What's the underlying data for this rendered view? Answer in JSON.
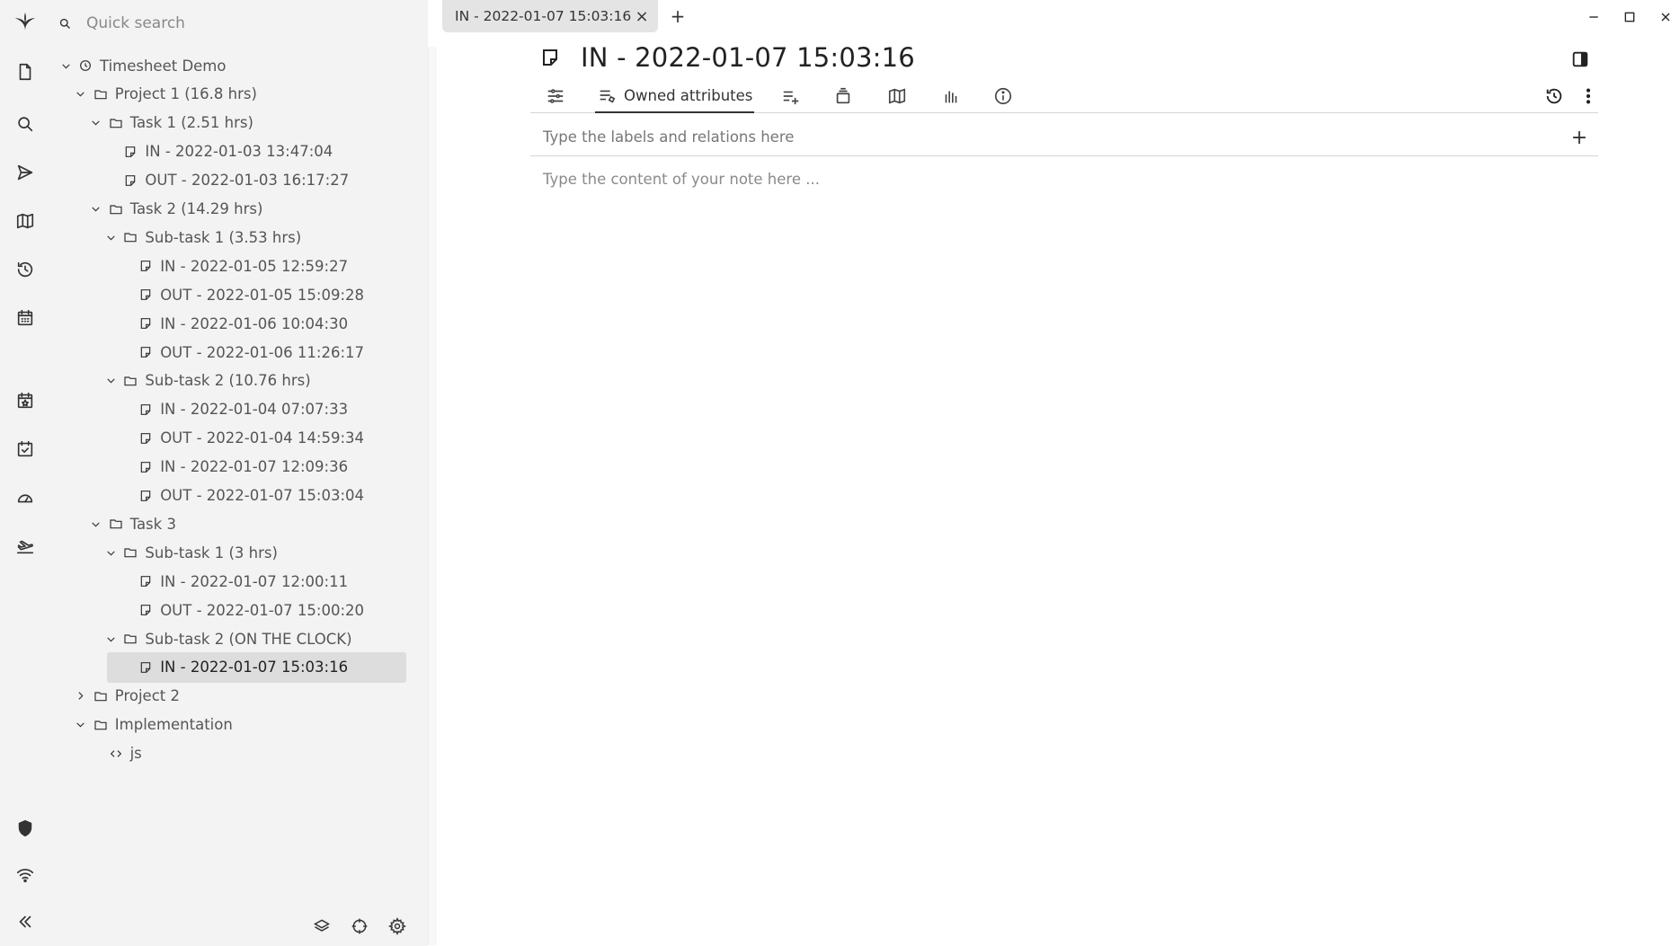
{
  "app": {
    "logo_icon": "trilium-logo-icon"
  },
  "launcher": {
    "buttons": [
      {
        "name": "new-note-button",
        "icon": "file-icon"
      },
      {
        "name": "search-button",
        "icon": "search-icon"
      },
      {
        "name": "jump-to-note-button",
        "icon": "send-icon"
      },
      {
        "name": "note-map-button",
        "icon": "map-icon"
      },
      {
        "name": "recent-changes-button",
        "icon": "history-icon"
      },
      {
        "name": "calendar-button",
        "icon": "calendar-icon"
      },
      {
        "name": "bookmark-button",
        "icon": "calendar-star-icon"
      },
      {
        "name": "todo-button",
        "icon": "calendar-check-icon"
      },
      {
        "name": "dashboard-button",
        "icon": "gauge-icon"
      },
      {
        "name": "sync-button",
        "icon": "plane-icon"
      },
      {
        "name": "protected-session-button",
        "icon": "shield-icon"
      },
      {
        "name": "sync-status-button",
        "icon": "wifi-icon"
      },
      {
        "name": "collapse-launcher-button",
        "icon": "double-chevron-left-icon"
      }
    ]
  },
  "search": {
    "placeholder": "Quick search"
  },
  "tree": {
    "nodes": [
      {
        "label": "Timesheet Demo",
        "depth": 0,
        "expanded": true,
        "icon": "clock-icon"
      },
      {
        "label": "Project 1 (16.8 hrs)",
        "depth": 1,
        "expanded": true,
        "icon": "folder-icon"
      },
      {
        "label": "Task 1 (2.51 hrs)",
        "depth": 2,
        "expanded": true,
        "icon": "folder-icon"
      },
      {
        "label": "IN - 2022-01-03 13:47:04",
        "depth": 3,
        "icon": "note-icon"
      },
      {
        "label": "OUT - 2022-01-03 16:17:27",
        "depth": 3,
        "icon": "note-icon"
      },
      {
        "label": "Task 2 (14.29 hrs)",
        "depth": 2,
        "expanded": true,
        "icon": "folder-icon"
      },
      {
        "label": "Sub-task 1 (3.53 hrs)",
        "depth": 3,
        "expanded": true,
        "icon": "folder-icon"
      },
      {
        "label": "IN - 2022-01-05 12:59:27",
        "depth": 4,
        "icon": "note-icon"
      },
      {
        "label": "OUT - 2022-01-05 15:09:28",
        "depth": 4,
        "icon": "note-icon"
      },
      {
        "label": "IN - 2022-01-06 10:04:30",
        "depth": 4,
        "icon": "note-icon"
      },
      {
        "label": "OUT - 2022-01-06 11:26:17",
        "depth": 4,
        "icon": "note-icon"
      },
      {
        "label": "Sub-task 2 (10.76 hrs)",
        "depth": 3,
        "expanded": true,
        "icon": "folder-icon"
      },
      {
        "label": "IN - 2022-01-04 07:07:33",
        "depth": 4,
        "icon": "note-icon"
      },
      {
        "label": "OUT - 2022-01-04 14:59:34",
        "depth": 4,
        "icon": "note-icon"
      },
      {
        "label": "IN - 2022-01-07 12:09:36",
        "depth": 4,
        "icon": "note-icon"
      },
      {
        "label": "OUT - 2022-01-07 15:03:04",
        "depth": 4,
        "icon": "note-icon"
      },
      {
        "label": "Task 3",
        "depth": 2,
        "expanded": true,
        "icon": "folder-icon"
      },
      {
        "label": "Sub-task 1 (3 hrs)",
        "depth": 3,
        "expanded": true,
        "icon": "folder-icon"
      },
      {
        "label": "IN - 2022-01-07 12:00:11",
        "depth": 4,
        "icon": "note-icon"
      },
      {
        "label": "OUT - 2022-01-07 15:00:20",
        "depth": 4,
        "icon": "note-icon"
      },
      {
        "label": "Sub-task 2 (ON THE CLOCK)",
        "depth": 3,
        "expanded": true,
        "icon": "folder-icon"
      },
      {
        "label": "IN - 2022-01-07 15:03:16",
        "depth": 4,
        "icon": "note-icon",
        "active": true
      },
      {
        "label": "Project 2",
        "depth": 1,
        "expanded": false,
        "icon": "folder-icon"
      },
      {
        "label": "Implementation",
        "depth": 1,
        "expanded": true,
        "icon": "folder-icon"
      },
      {
        "label": "js",
        "depth": 2,
        "icon": "code-icon"
      }
    ]
  },
  "tabs": [
    {
      "label": "IN - 2022-01-07 15:03:16",
      "active": true
    }
  ],
  "new_tab_symbol": "+",
  "close_tab_symbol": "×",
  "note": {
    "title": "IN - 2022-01-07 15:03:16",
    "ribbon": {
      "active_label": "Owned attributes"
    },
    "attributes_placeholder": "Type the labels and relations here",
    "add_symbol": "+",
    "content_placeholder": "Type the content of your note here ..."
  }
}
